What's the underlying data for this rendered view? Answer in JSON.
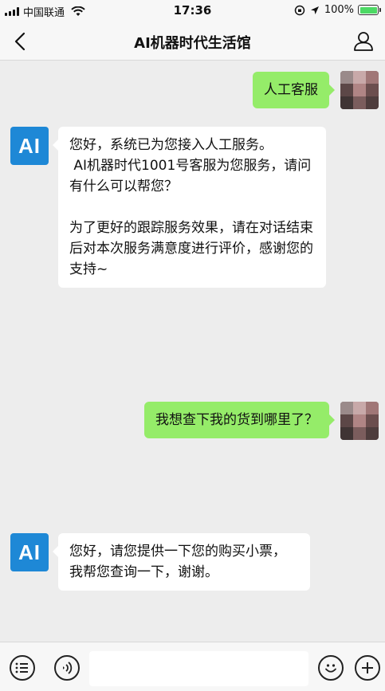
{
  "status_bar": {
    "carrier": "中国联通",
    "time": "17:36",
    "battery_percent": "100%",
    "battery_level": 1.0,
    "icons": [
      "signal-icon",
      "wifi-icon",
      "orientation-lock-icon",
      "location-icon",
      "battery-icon"
    ]
  },
  "nav": {
    "title": "AI机器时代生活馆",
    "back_icon": "back-arrow-icon",
    "profile_icon": "user-profile-icon"
  },
  "messages": [
    {
      "side": "right",
      "text": "人工客服"
    },
    {
      "side": "left",
      "avatar_text": "AI",
      "text": "您好，系统已为您接入人工服务。\n AI机器时代1001号客服为您服务，请问有什么可以帮您？\n\n为了更好的跟踪服务效果，请在对话结束后对本次服务满意度进行评价，感谢您的支持~"
    },
    {
      "side": "right",
      "text": "我想查下我的货到哪里了？"
    },
    {
      "side": "left",
      "avatar_text": "AI",
      "text": "您好，请您提供一下您的购买小票，我帮您查询一下，谢谢。"
    }
  ],
  "input_bar": {
    "menu_icon": "menu-list-icon",
    "voice_icon": "voice-icon",
    "emoji_icon": "emoji-icon",
    "plus_icon": "plus-icon",
    "value": ""
  },
  "colors": {
    "ai_avatar": "#1e88d6",
    "user_bubble": "#95ec69",
    "bot_bubble": "#ffffff",
    "background": "#ededed"
  }
}
